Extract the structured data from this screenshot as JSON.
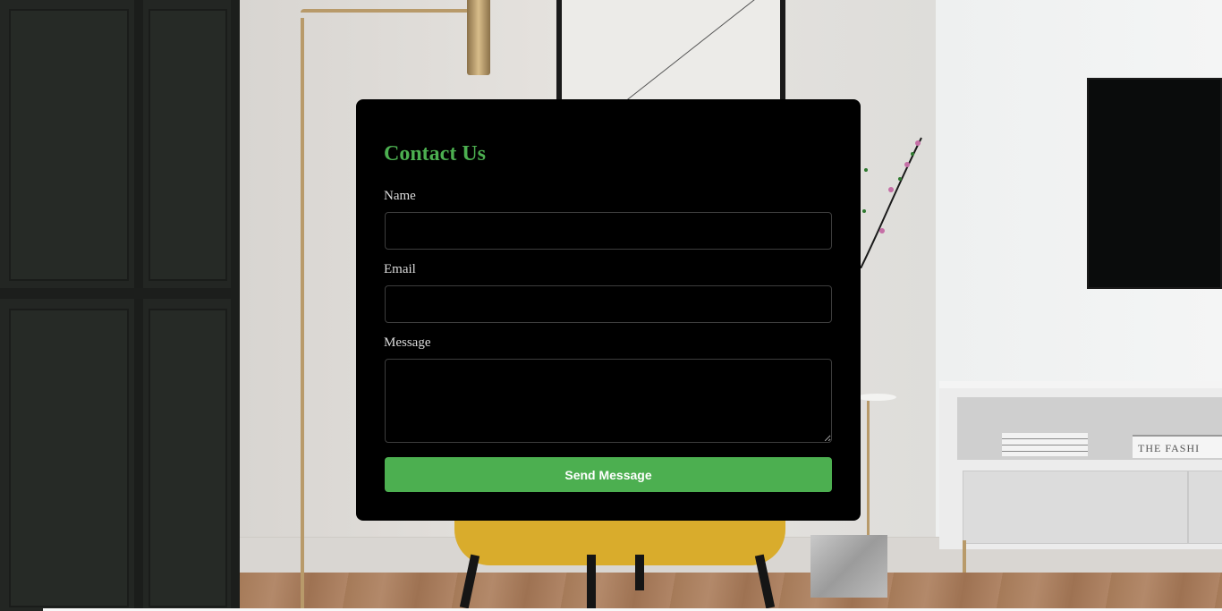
{
  "contact_form": {
    "title": "Contact Us",
    "name_label": "Name",
    "name_value": "",
    "email_label": "Email",
    "email_value": "",
    "message_label": "Message",
    "message_value": "",
    "submit_label": "Send Message"
  },
  "background": {
    "books_spine_text": "THE FASHI"
  },
  "colors": {
    "accent": "#4caf50",
    "card_background": "#000000",
    "label_text": "#dddddd",
    "input_border": "#3d3d3d"
  },
  "icons": {
    "textarea_resize": "resize-handle-icon"
  }
}
